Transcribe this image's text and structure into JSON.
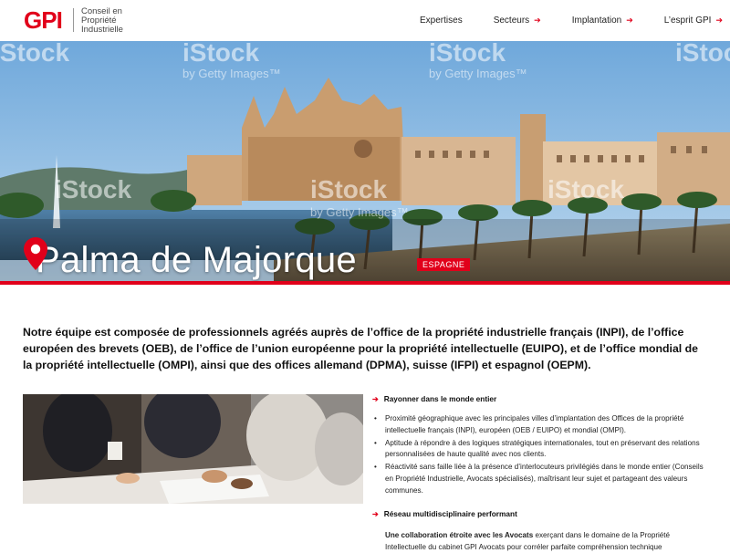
{
  "header": {
    "logo_text": "GPI",
    "tagline": "Conseil en Propriété Industrielle",
    "nav": [
      {
        "label": "Expertises",
        "has_arrow": false
      },
      {
        "label": "Secteurs",
        "has_arrow": true
      },
      {
        "label": "Implantation",
        "has_arrow": true
      },
      {
        "label": "L’esprit GPI",
        "has_arrow": true
      }
    ]
  },
  "hero": {
    "title": "Palma de Majorque",
    "country": "ESPAGNE",
    "pin_icon": "location-pin-icon",
    "watermark_main": "iStock",
    "watermark_sub": "by Getty Images™"
  },
  "intro": "Notre équipe est composée de professionnels agréés auprès de l’office de la propriété industrielle français (INPI), de l’office européen des brevets (OEB), de l’office de l’union européenne pour la propriété intellectuelle (EUIPO), et de l’office mondial de la propriété intellectuelle (OMPI), ainsi que des offices allemand (DPMA), suisse (IFPI) et espagnol (OEPM).",
  "sections": [
    {
      "heading": "Rayonner dans le monde entier",
      "bullets": [
        "Proximité géographique avec les principales villes d’implantation des Offices de la propriété intellectuelle français (INPI), européen (OEB / EUIPO) et mondial (OMPI).",
        "Aptitude à répondre à des logiques stratégiques internationales, tout en préservant des relations personnalisées de haute qualité avec nos clients.",
        "Réactivité sans faille liée à la présence d’interlocuteurs privilégiés dans le monde entier (Conseils en Propriété Industrielle, Avocats spécialisés), maîtrisant leur sujet et partageant des valeurs communes."
      ]
    },
    {
      "heading": "Réseau multidisciplinaire performant",
      "para_bold": "Une collaboration étroite avec les Avocats",
      "para_rest": " exerçant dans le domaine de la Propriété Intellectuelle du cabinet GPI Avocats pour corréler parfaite compréhension technique"
    }
  ],
  "colors": {
    "accent": "#e1001a",
    "text": "#111111",
    "white": "#ffffff"
  }
}
